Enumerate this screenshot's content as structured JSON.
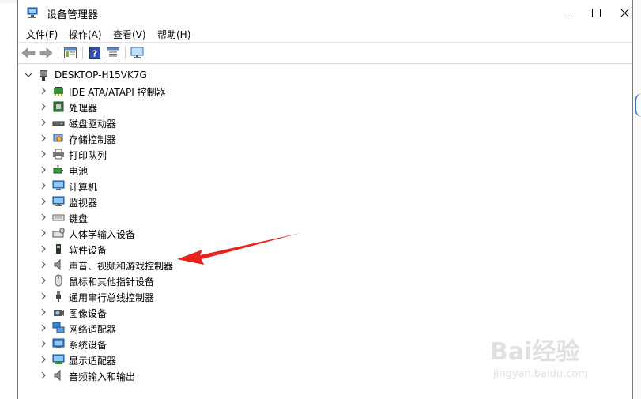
{
  "window": {
    "title": "设备管理器"
  },
  "menubar": [
    "文件(F)",
    "操作(A)",
    "查看(V)",
    "帮助(H)"
  ],
  "tree": {
    "root": "DESKTOP-H15VK7G",
    "categories": [
      {
        "label": "IDE ATA/ATAPI 控制器",
        "icon": "ide-controller-icon"
      },
      {
        "label": "处理器",
        "icon": "processor-icon"
      },
      {
        "label": "磁盘驱动器",
        "icon": "disk-drive-icon"
      },
      {
        "label": "存储控制器",
        "icon": "storage-controller-icon"
      },
      {
        "label": "打印队列",
        "icon": "printer-icon"
      },
      {
        "label": "电池",
        "icon": "battery-icon"
      },
      {
        "label": "计算机",
        "icon": "computer-icon"
      },
      {
        "label": "监视器",
        "icon": "monitor-icon"
      },
      {
        "label": "键盘",
        "icon": "keyboard-icon"
      },
      {
        "label": "人体学输入设备",
        "icon": "hid-icon"
      },
      {
        "label": "软件设备",
        "icon": "software-device-icon"
      },
      {
        "label": "声音、视频和游戏控制器",
        "icon": "speaker-icon"
      },
      {
        "label": "鼠标和其他指针设备",
        "icon": "mouse-icon"
      },
      {
        "label": "通用串行总线控制器",
        "icon": "usb-icon"
      },
      {
        "label": "图像设备",
        "icon": "camera-icon"
      },
      {
        "label": "网络适配器",
        "icon": "network-adapter-icon"
      },
      {
        "label": "系统设备",
        "icon": "system-device-icon"
      },
      {
        "label": "显示适配器",
        "icon": "display-adapter-icon"
      },
      {
        "label": "音频输入和输出",
        "icon": "audio-io-icon"
      }
    ]
  },
  "watermark": {
    "main": "Bai经验",
    "sub": "jingyan.baidu.com"
  },
  "colors": {
    "accent": "#1e6fd9",
    "arrow": "#e8231f"
  }
}
